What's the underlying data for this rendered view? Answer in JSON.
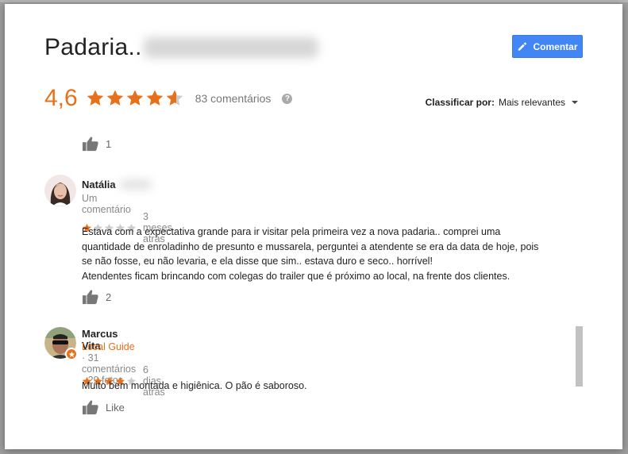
{
  "place": {
    "title": "Padaria"
  },
  "header": {
    "comment_button": "Comentar",
    "rating": "4,6",
    "rating_value": 4.6,
    "rating_max": 5,
    "review_count": "83 comentários",
    "help_icon": "?",
    "sort_label": "Classificar por:",
    "sort_value": "Mais relevantes"
  },
  "colors": {
    "accent_orange": "#e7711b",
    "button_blue": "#4285f4",
    "star_empty": "#cccccc"
  },
  "top_like": {
    "count": "1"
  },
  "reviews": [
    {
      "name": "Natália",
      "meta": "Um comentário",
      "stars": 1,
      "date": "3 meses atrás",
      "text_lines": [
        "Estava com a expectativa grande para ir visitar pela primeira vez a nova padaria.. comprei uma",
        "quantidade de enroladinho de presunto e mussarela, perguntei a atendente se era da data de hoje, pois",
        "se não fosse, eu não levaria, e ela disse que sim.. estava duro e seco.. horrível!",
        "Atendentes ficam brincando com colegas do trailer que é próximo ao local, na frente dos clientes."
      ],
      "like": "2"
    },
    {
      "name": "Marcus Vita",
      "guide_label": "Local Guide",
      "meta": " · 31 comentários · 29 fotos",
      "stars": 4,
      "date": "6 dias atrás",
      "text_lines": [
        "Muito bem montada e higiênica. O pão é saboroso."
      ],
      "like": "Like"
    }
  ],
  "icons": {
    "thumbs_up": "thumbs-up-icon",
    "pencil": "pencil-icon",
    "help": "help-icon",
    "local_guide_badge": "local-guide-star-icon"
  }
}
